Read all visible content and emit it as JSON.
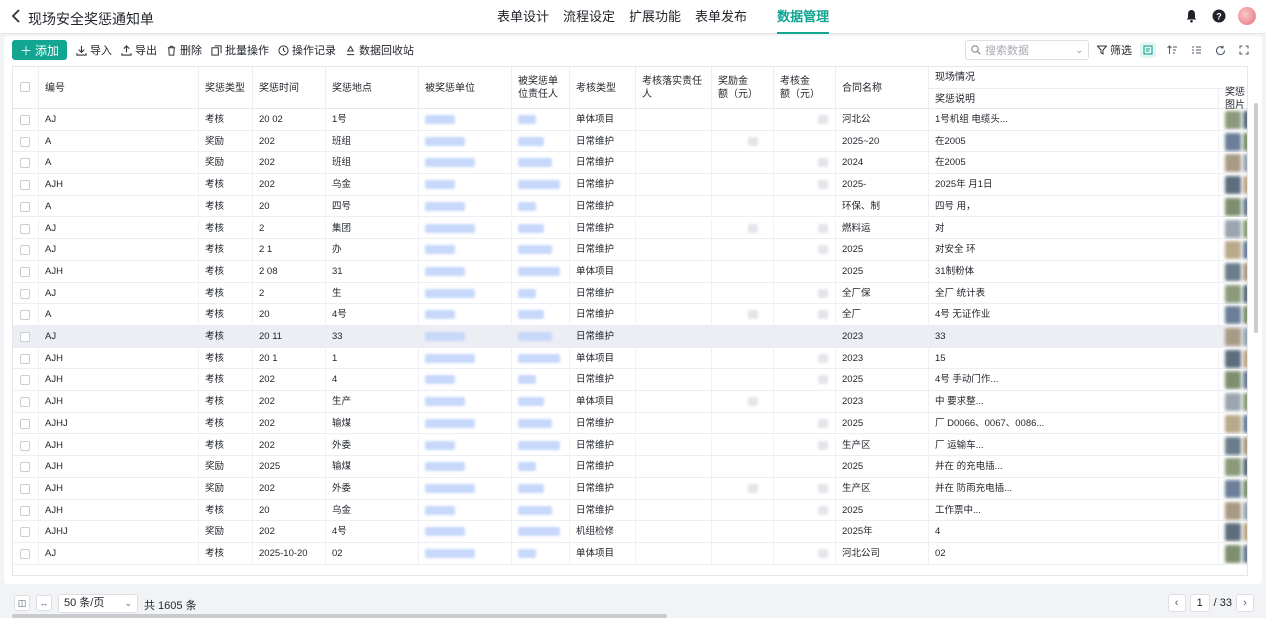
{
  "header": {
    "title": "现场安全奖惩通知单",
    "tabs": [
      {
        "label": "表单设计"
      },
      {
        "label": "流程设定"
      },
      {
        "label": "扩展功能"
      },
      {
        "label": "表单发布"
      },
      {
        "label": "数据管理"
      }
    ],
    "active_tab": "数据管理",
    "accent": "#12a591"
  },
  "toolbar": {
    "add": "添加",
    "import": "导入",
    "export": "导出",
    "delete": "删除",
    "batch": "批量操作",
    "log": "操作记录",
    "recycle": "数据回收站",
    "search_placeholder": "搜索数据",
    "filter": "筛选"
  },
  "columns": {
    "id": "编号",
    "type": "奖惩类型",
    "time": "奖惩时间",
    "place": "奖惩地点",
    "unit": "被奖惩单位",
    "person": "被奖惩单位责任人",
    "check_type": "考核类型",
    "implementer": "考核落实责任人",
    "reward": "奖励金额（元）",
    "penalty": "考核金额（元）",
    "contract": "合同名称",
    "group": "现场情况",
    "desc": "奖惩说明",
    "pic": "奖惩图片"
  },
  "rows": [
    {
      "id": "AJ",
      "type": "考核",
      "time": "20  02",
      "place": "1号",
      "check": "单体项目",
      "contract": "河北公",
      "desc": "1号机组  电缆头...",
      "hl": false
    },
    {
      "id": "A",
      "type": "奖励",
      "time": "202",
      "place": "班组",
      "check": "日常维护",
      "contract": "2025~20",
      "desc": "在2005",
      "hl": false
    },
    {
      "id": "A",
      "type": "奖励",
      "time": "202",
      "place": "班组",
      "check": "日常维护",
      "contract": "2024",
      "desc": "在2005",
      "hl": false
    },
    {
      "id": "AJH",
      "type": "考核",
      "time": "202",
      "place": "乌金",
      "check": "日常维护",
      "contract": "2025-",
      "desc": "2025年  月1日",
      "hl": false
    },
    {
      "id": "A",
      "type": "考核",
      "time": "20",
      "place": "四号",
      "check": "日常维护",
      "contract": "环保、制",
      "desc": "四号  用，",
      "hl": false
    },
    {
      "id": "AJ",
      "type": "考核",
      "time": "2",
      "place": "集团",
      "check": "日常维护",
      "contract": "燃料运",
      "desc": "对",
      "hl": false
    },
    {
      "id": "AJ",
      "type": "考核",
      "time": "2  1",
      "place": "办",
      "check": "日常维护",
      "contract": "2025",
      "desc": "对安全  环",
      "hl": false
    },
    {
      "id": "AJH",
      "type": "考核",
      "time": "2  08",
      "place": "31",
      "check": "单体项目",
      "contract": "2025",
      "desc": "31制粉体",
      "hl": false
    },
    {
      "id": "AJ",
      "type": "考核",
      "time": "2",
      "place": "生",
      "check": "日常维护",
      "contract": "全厂保",
      "desc": "全厂  统计表",
      "hl": false
    },
    {
      "id": "A",
      "type": "考核",
      "time": "20",
      "place": "4号",
      "check": "日常维护",
      "contract": "全厂",
      "desc": "4号  无证作业",
      "hl": false
    },
    {
      "id": "AJ",
      "type": "考核",
      "time": "20  11",
      "place": "33",
      "check": "日常维护",
      "contract": "2023",
      "desc": "33",
      "hl": true
    },
    {
      "id": "AJH",
      "type": "考核",
      "time": "20  1",
      "place": "1",
      "check": "单体项目",
      "contract": "2023",
      "desc": "15",
      "hl": false
    },
    {
      "id": "AJH",
      "type": "考核",
      "time": "202",
      "place": "4",
      "check": "日常维护",
      "contract": "2025",
      "desc": "4号  手动门作...",
      "hl": false
    },
    {
      "id": "AJH",
      "type": "考核",
      "time": "202",
      "place": "生产",
      "check": "单体项目",
      "contract": "2023",
      "desc": "中  要求整...",
      "hl": false
    },
    {
      "id": "AJHJ",
      "type": "考核",
      "time": "202",
      "place": "输煤",
      "check": "日常维护",
      "contract": "2025",
      "desc": "厂  D0066、0067、0086...",
      "hl": false
    },
    {
      "id": "AJH",
      "type": "考核",
      "time": "202",
      "place": "外委",
      "check": "日常维护",
      "contract": "生产区",
      "desc": "厂  运输车...",
      "hl": false
    },
    {
      "id": "AJH",
      "type": "奖励",
      "time": "2025",
      "place": "输煤",
      "check": "日常维护",
      "contract": "2025",
      "desc": "并在  的充电插...",
      "hl": false
    },
    {
      "id": "AJH",
      "type": "奖励",
      "time": "202",
      "place": "外委",
      "check": "日常维护",
      "contract": "生产区",
      "desc": "并在  防雨充电插...",
      "hl": false
    },
    {
      "id": "AJH",
      "type": "考核",
      "time": "20",
      "place": "乌金",
      "check": "日常维护",
      "contract": "2025",
      "desc": "工作票中...",
      "hl": false
    },
    {
      "id": "AJHJ",
      "type": "奖励",
      "time": "202",
      "place": "4号",
      "check": "机组检修",
      "contract": "2025年",
      "desc": "4",
      "hl": false
    },
    {
      "id": "AJ",
      "type": "考核",
      "time": "2025-10-20",
      "place": "02",
      "check": "单体项目",
      "contract": "河北公司",
      "desc": "02",
      "hl": false
    }
  ],
  "footer": {
    "page_size": "50 条/页",
    "total": "共 1605 条",
    "page": "1",
    "pages": "/ 33"
  }
}
